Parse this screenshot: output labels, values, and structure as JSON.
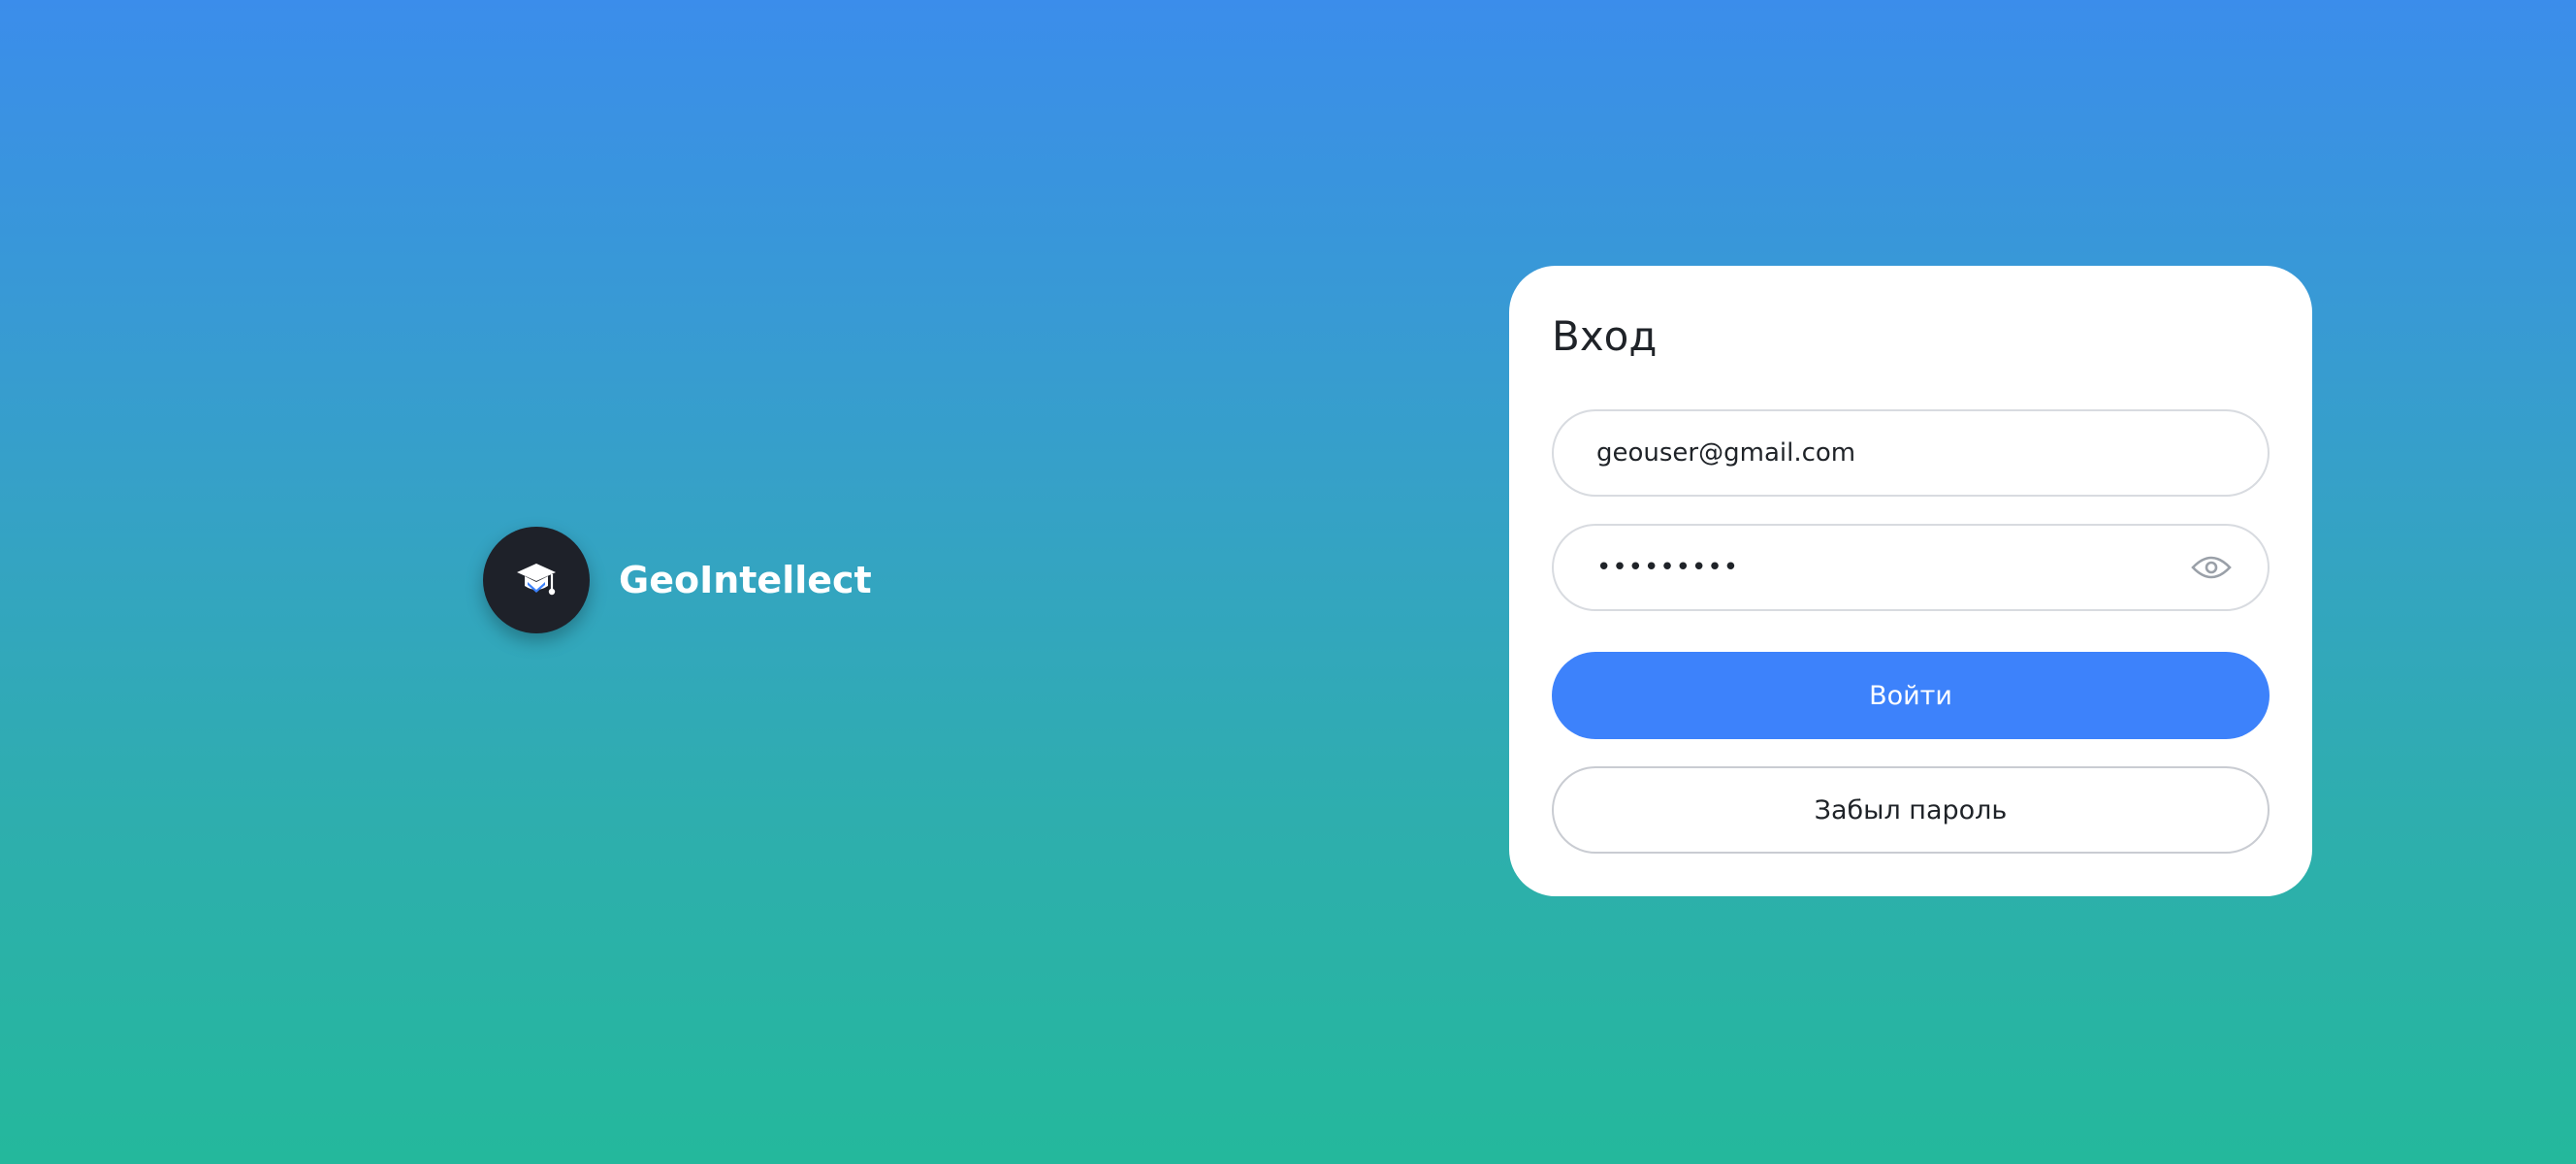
{
  "brand": {
    "name": "GeoIntellect",
    "logo_icon": "graduation-cap-icon"
  },
  "login": {
    "title": "Вход",
    "email_value": "geouser@gmail.com",
    "password_value": "•••••••••",
    "show_password_icon": "eye-icon",
    "submit_label": "Войти",
    "forgot_label": "Забыл пароль"
  },
  "colors": {
    "primary": "#3d82fb",
    "background_top": "#3b8deb",
    "background_bottom": "#24b89c",
    "logo_bg": "#1e2129"
  }
}
